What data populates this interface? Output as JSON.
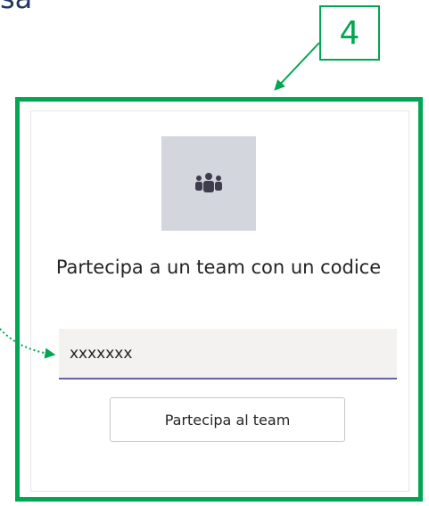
{
  "heading_fragment": "sa",
  "callout": {
    "step_number": "4",
    "accent_color": "#00a651"
  },
  "join_card": {
    "icon": "teams-group-icon",
    "tile_color": "#d3d6dd",
    "title": "Partecipa a un team con un codice",
    "code_input": {
      "value": "xxxxxxx",
      "underline_color": "#6264a7"
    },
    "join_button_label": "Partecipa al team"
  }
}
